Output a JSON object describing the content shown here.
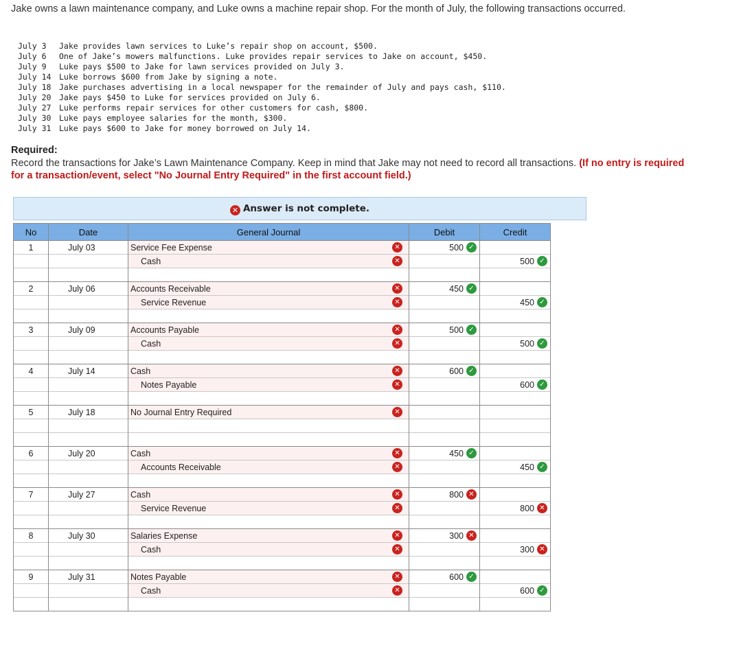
{
  "intro": "Jake owns a lawn maintenance company, and Luke owns a machine repair shop. For the month of July, the following transactions occurred.",
  "transactions": [
    {
      "date": "July 3",
      "text": "Jake provides lawn services to Luke’s repair shop on account, $500."
    },
    {
      "date": "July 6",
      "text": "One of Jake’s mowers malfunctions. Luke provides repair services to Jake on account, $450."
    },
    {
      "date": "July 9",
      "text": "Luke pays $500 to Jake for lawn services provided on July 3."
    },
    {
      "date": "July 14",
      "text": "Luke borrows $600 from Jake by signing a note."
    },
    {
      "date": "July 18",
      "text": "Jake purchases advertising in a local newspaper for the remainder of July and pays cash, $110."
    },
    {
      "date": "July 20",
      "text": "Jake pays $450 to Luke for services provided on July 6."
    },
    {
      "date": "July 27",
      "text": "Luke performs repair services for other customers for cash, $800."
    },
    {
      "date": "July 30",
      "text": "Luke pays employee salaries for the month, $300."
    },
    {
      "date": "July 31",
      "text": "Luke pays $600 to Jake for money borrowed on July 14."
    }
  ],
  "required": {
    "heading": "Required:",
    "text": "Record the transactions for Jake’s Lawn Maintenance Company. Keep in mind that Jake may not need to record all transactions.",
    "note": "(If no entry is required for a transaction/event, select \"No Journal Entry Required\" in the first account field.)"
  },
  "banner": {
    "icon": "x-circle-icon",
    "text": "Answer is not complete."
  },
  "table": {
    "headers": {
      "no": "No",
      "date": "Date",
      "journal": "General Journal",
      "debit": "Debit",
      "credit": "Credit"
    },
    "entries": [
      {
        "no": "1",
        "date": "July 03",
        "lines": [
          {
            "account": "Service Fee Expense",
            "debit": "500",
            "debit_status": "correct",
            "credit": "",
            "credit_status": ""
          },
          {
            "account": "Cash",
            "debit": "",
            "debit_status": "",
            "credit": "500",
            "credit_status": "correct"
          }
        ]
      },
      {
        "no": "2",
        "date": "July 06",
        "lines": [
          {
            "account": "Accounts Receivable",
            "debit": "450",
            "debit_status": "correct",
            "credit": "",
            "credit_status": ""
          },
          {
            "account": "Service Revenue",
            "debit": "",
            "debit_status": "",
            "credit": "450",
            "credit_status": "correct"
          }
        ]
      },
      {
        "no": "3",
        "date": "July 09",
        "lines": [
          {
            "account": "Accounts Payable",
            "debit": "500",
            "debit_status": "correct",
            "credit": "",
            "credit_status": ""
          },
          {
            "account": "Cash",
            "debit": "",
            "debit_status": "",
            "credit": "500",
            "credit_status": "correct"
          }
        ]
      },
      {
        "no": "4",
        "date": "July 14",
        "lines": [
          {
            "account": "Cash",
            "debit": "600",
            "debit_status": "correct",
            "credit": "",
            "credit_status": ""
          },
          {
            "account": "Notes Payable",
            "debit": "",
            "debit_status": "",
            "credit": "600",
            "credit_status": "correct"
          }
        ]
      },
      {
        "no": "5",
        "date": "July 18",
        "lines": [
          {
            "account": "No Journal Entry Required",
            "debit": "",
            "debit_status": "",
            "credit": "",
            "credit_status": ""
          },
          {
            "account": "",
            "debit": "",
            "debit_status": "",
            "credit": "",
            "credit_status": ""
          }
        ]
      },
      {
        "no": "6",
        "date": "July 20",
        "lines": [
          {
            "account": "Cash",
            "debit": "450",
            "debit_status": "correct",
            "credit": "",
            "credit_status": ""
          },
          {
            "account": "Accounts Receivable",
            "debit": "",
            "debit_status": "",
            "credit": "450",
            "credit_status": "correct"
          }
        ]
      },
      {
        "no": "7",
        "date": "July 27",
        "lines": [
          {
            "account": "Cash",
            "debit": "800",
            "debit_status": "incorrect",
            "credit": "",
            "credit_status": ""
          },
          {
            "account": "Service Revenue",
            "debit": "",
            "debit_status": "",
            "credit": "800",
            "credit_status": "incorrect"
          }
        ]
      },
      {
        "no": "8",
        "date": "July 30",
        "lines": [
          {
            "account": "Salaries Expense",
            "debit": "300",
            "debit_status": "incorrect",
            "credit": "",
            "credit_status": ""
          },
          {
            "account": "Cash",
            "debit": "",
            "debit_status": "",
            "credit": "300",
            "credit_status": "incorrect"
          }
        ]
      },
      {
        "no": "9",
        "date": "July 31",
        "lines": [
          {
            "account": "Notes Payable",
            "debit": "600",
            "debit_status": "correct",
            "credit": "",
            "credit_status": ""
          },
          {
            "account": "Cash",
            "debit": "",
            "debit_status": "",
            "credit": "600",
            "credit_status": "correct"
          }
        ]
      }
    ]
  },
  "colors": {
    "header_blue": "#7aaee4",
    "banner_bg": "#dcebf8",
    "correct_green": "#2e9a3e",
    "incorrect_red": "#c8231f",
    "note_red": "#c11a1a"
  }
}
